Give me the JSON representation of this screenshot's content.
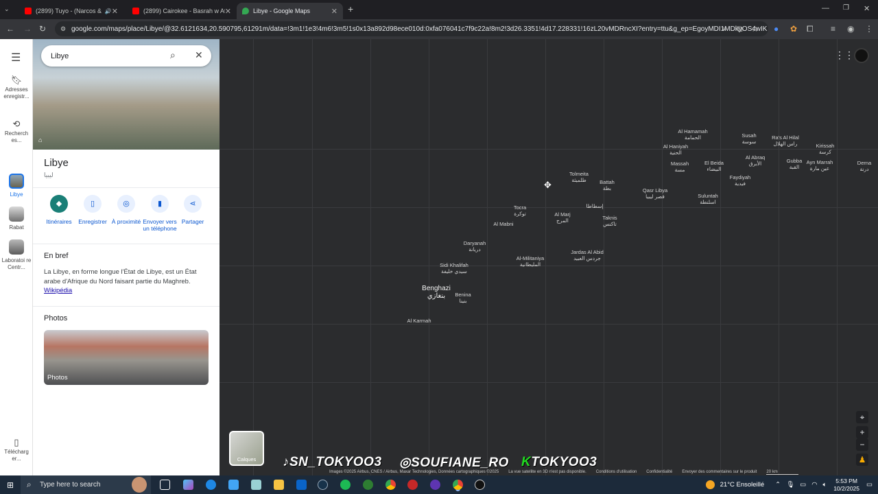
{
  "tabs": [
    {
      "title": "(2899) Tuyo - (Narcos & Na",
      "color": "#ff0000"
    },
    {
      "title": "(2899) Cairokee - Basrah w Atoi",
      "color": "#ff0000"
    },
    {
      "title": "Libye - Google Maps",
      "color": "#34a853"
    }
  ],
  "address_bar": "google.com/maps/place/Libye/@32.6121634,20.590795,61291m/data=!3m1!1e3!4m6!3m5!1s0x13a892d98ece010d:0xfa076041c7f9c22a!8m2!3d26.3351!4d17.228331!16zL20vMDRncXI?entry=ttu&g_ep=EgoyMDI1MDkyOS4wIK",
  "rail": {
    "saved": "Adresses enregistr...",
    "recent": "Recherch es...",
    "items": [
      {
        "label": "Libye"
      },
      {
        "label": "Rabat"
      },
      {
        "label": "Laboratoi re Centr..."
      }
    ],
    "download": "Télécharg er..."
  },
  "search": {
    "value": "Libye"
  },
  "place": {
    "title": "Libye",
    "subtitle": "ليبيا"
  },
  "actions": [
    {
      "label": "Itinéraires",
      "icon": "directions-icon"
    },
    {
      "label": "Enregistrer",
      "icon": "bookmark-icon"
    },
    {
      "label": "À proximité",
      "icon": "nearby-icon"
    },
    {
      "label": "Envoyer vers un téléphone",
      "icon": "phone-icon"
    },
    {
      "label": "Partager",
      "icon": "share-icon"
    }
  ],
  "brief": {
    "heading": "En bref",
    "text": "La Libye, en forme longue l'État de Libye, est un État arabe d'Afrique du Nord faisant partie du Maghreb. ",
    "link": "Wikipédia"
  },
  "photos": {
    "heading": "Photos",
    "label": "Photos"
  },
  "map": {
    "cities": [
      {
        "name": "Al Hamamah",
        "ar": "الحمامة"
      },
      {
        "name": "Al Haniyah",
        "ar": "الحنية"
      },
      {
        "name": "Susah",
        "ar": "سوسة"
      },
      {
        "name": "Ra's Al Hilal",
        "ar": "راس الهلال"
      },
      {
        "name": "Kirissah",
        "ar": "كرسة"
      },
      {
        "name": "Massah",
        "ar": "مسة"
      },
      {
        "name": "El Beida",
        "ar": "البيضاء"
      },
      {
        "name": "Al Abraq",
        "ar": "الأبرق"
      },
      {
        "name": "Gubba",
        "ar": "القبة"
      },
      {
        "name": "Ayn Marrah",
        "ar": "عين مارة"
      },
      {
        "name": "Derna",
        "ar": "درنة"
      },
      {
        "name": "Tolmeita",
        "ar": "طلميثة"
      },
      {
        "name": "Battah",
        "ar": "بطة"
      },
      {
        "name": "Faydiyah",
        "ar": "فيدية"
      },
      {
        "name": "Qasr Libya",
        "ar": "قصر ليبيا"
      },
      {
        "name": "Suluntah",
        "ar": "اسلنطة"
      },
      {
        "name": "Tocra",
        "ar": "توكرة"
      },
      {
        "name": "",
        "ar": "إسطاطا"
      },
      {
        "name": "Al Marj",
        "ar": "المرج"
      },
      {
        "name": "Taknis",
        "ar": "تاكنس"
      },
      {
        "name": "Al Mabni",
        "ar": ""
      },
      {
        "name": "Daryanah",
        "ar": "دريانة"
      },
      {
        "name": "Jardas Al Abid",
        "ar": "جردس العبيد"
      },
      {
        "name": "Al-Militaniya",
        "ar": "المليطانية"
      },
      {
        "name": "Sidi Khalifah",
        "ar": "سيدي خليفة"
      },
      {
        "name": "Benghazi",
        "ar": "بنغازي"
      },
      {
        "name": "Benina",
        "ar": "بنينا"
      },
      {
        "name": "Al Karmah",
        "ar": ""
      }
    ],
    "layers_label": "Calques",
    "attribution": [
      "Images ©2025 Airbus, CNES / Airbus, Maxar Technologies, Données cartographiques ©2025",
      "La vue satellite en 3D n'est pas disponible.",
      "Conditions d'utilisation",
      "Confidentialité",
      "Envoyer des commentaires sur le produit",
      "20 km"
    ],
    "overlays": [
      "SN_TOKYOO3",
      "SOUFIANE_RO",
      "TOKYOO3"
    ]
  },
  "taskbar": {
    "search_placeholder": "Type here to search",
    "weather": "21°C  Ensoleillé",
    "time": "5:53 PM",
    "date": "10/2/2025"
  }
}
